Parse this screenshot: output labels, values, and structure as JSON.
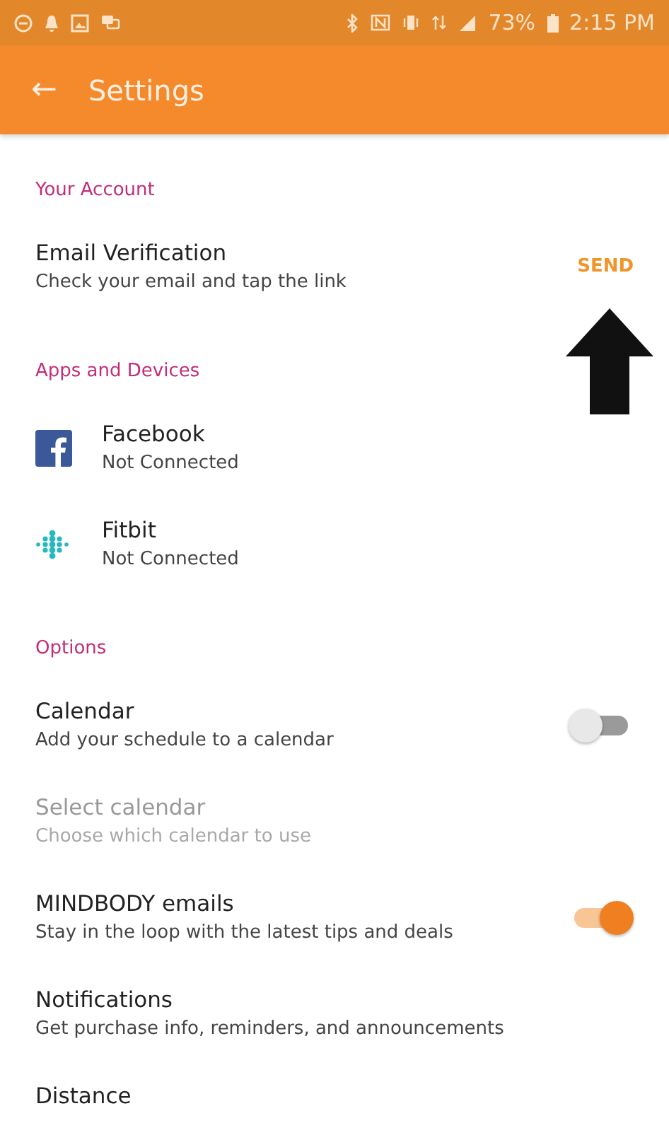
{
  "status_bar": {
    "battery": "73%",
    "time": "2:15 PM"
  },
  "app_bar": {
    "back": "←",
    "title": "Settings"
  },
  "sections": [
    {
      "header": "Your Account",
      "items": [
        {
          "kind": "action",
          "title": "Email Verification",
          "subtitle": "Check your email and tap the link",
          "action": "SEND"
        }
      ]
    },
    {
      "header": "Apps and Devices",
      "items": [
        {
          "kind": "facebook",
          "title": "Facebook",
          "subtitle": "Not Connected"
        },
        {
          "kind": "fitbit",
          "title": "Fitbit",
          "subtitle": "Not Connected"
        }
      ]
    },
    {
      "header": "Options",
      "items": [
        {
          "kind": "toggle",
          "title": "Calendar",
          "subtitle": "Add your schedule to a calendar",
          "on": false,
          "disabled": false
        },
        {
          "kind": "plain",
          "title": "Select calendar",
          "subtitle": "Choose which calendar to use",
          "disabled": true
        },
        {
          "kind": "toggle",
          "title": "MINDBODY emails",
          "subtitle": "Stay in the loop with the latest tips and deals",
          "on": true,
          "disabled": false
        },
        {
          "kind": "plain",
          "title": "Notifications",
          "subtitle": "Get purchase info, reminders, and announcements",
          "disabled": false
        },
        {
          "kind": "plain",
          "title": "Distance",
          "disabled": false
        }
      ]
    }
  ]
}
